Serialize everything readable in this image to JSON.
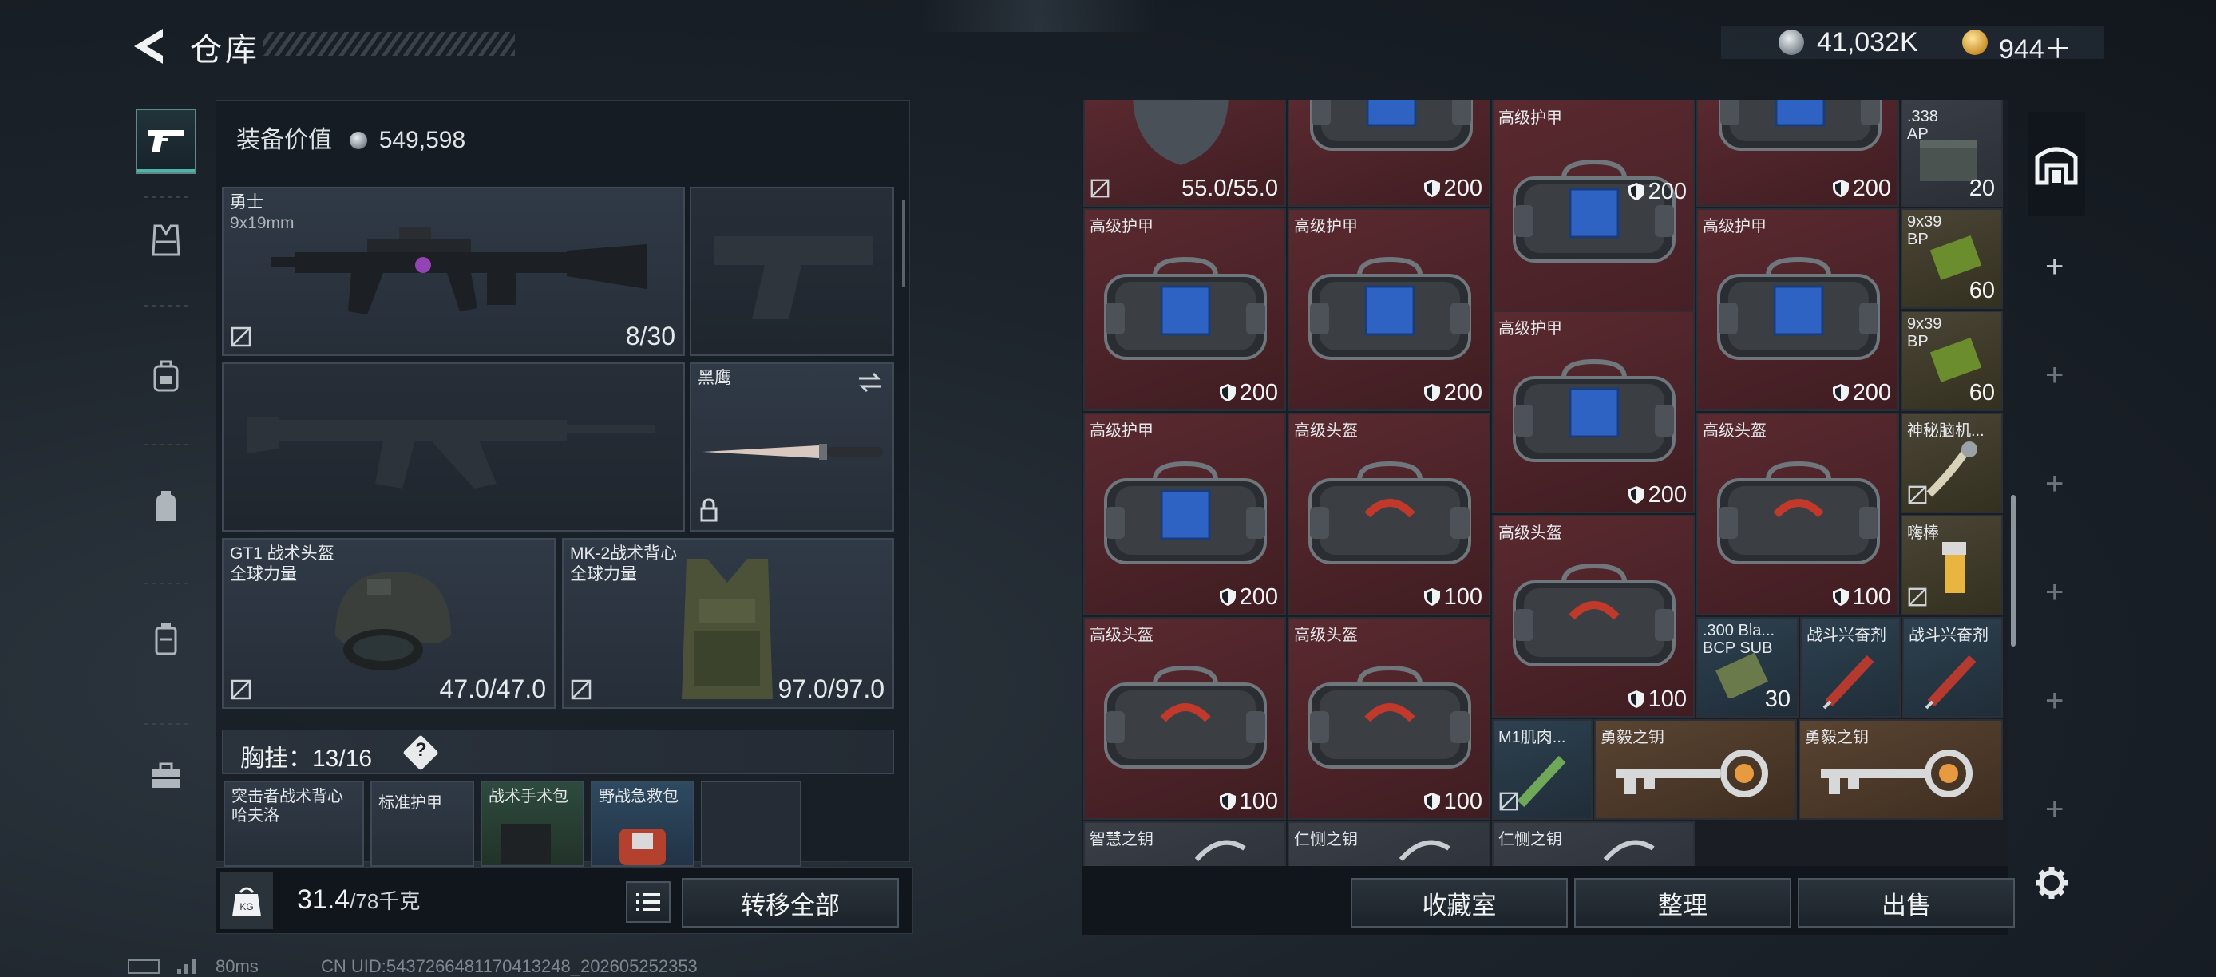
{
  "header": {
    "title": "仓库",
    "currency1": "41,032K",
    "currency2": "944＋"
  },
  "loadout": {
    "value_label": "装备价值",
    "value": "549,598",
    "primary": {
      "name": "勇士",
      "caliber": "9x19mm",
      "ammo": "8/30"
    },
    "melee": {
      "name": "黑鹰"
    },
    "helmet": {
      "name": "GT1 战术头盔",
      "brand": "全球力量",
      "durability": "47.0/47.0"
    },
    "vest": {
      "name": "MK-2战术背心",
      "brand": "全球力量",
      "durability": "97.0/97.0"
    },
    "chest_rig": {
      "label": "胸挂：13/16",
      "help": "?"
    },
    "chest_items": [
      "突击者战术背心",
      "哈夫洛",
      "标准护甲",
      "战术手术包",
      "野战急救包"
    ],
    "weight": "31.4",
    "weight_max": "/78千克",
    "transfer_all": "转移全部"
  },
  "stash": {
    "cells": [
      {
        "label": "",
        "num": "55.0/55.0"
      },
      {
        "label": "",
        "num": "200"
      },
      {
        "label": "高级护甲",
        "num": "200"
      },
      {
        "label": "",
        "num": "200"
      },
      {
        "label": ".338\nAP",
        "num": "20"
      },
      {
        "label": "高级护甲",
        "num": "200"
      },
      {
        "label": "高级护甲",
        "num": "200"
      },
      {
        "label": "",
        "num": "200"
      },
      {
        "label": "高级护甲",
        "num": "200"
      },
      {
        "label": "9x39\nBP",
        "num": "60"
      },
      {
        "label": "高级护甲",
        "num": "200"
      },
      {
        "label": "9x39\nBP",
        "num": "60"
      },
      {
        "label": "高级护甲",
        "num": "200"
      },
      {
        "label": "高级头盔",
        "num": "100"
      },
      {
        "label": "高级头盔",
        "num": "100"
      },
      {
        "label": "神秘脑机...",
        "num": ""
      },
      {
        "label": "嗨棒",
        "num": ""
      },
      {
        "label": "高级头盔",
        "num": "100"
      },
      {
        "label": "高级头盔",
        "num": "100"
      },
      {
        "label": "高级头盔",
        "num": "100"
      },
      {
        "label": ".300 Bla...\nBCP SUB",
        "num": "30"
      },
      {
        "label": "战斗兴奋剂",
        "num": ""
      },
      {
        "label": "战斗兴奋剂",
        "num": ""
      },
      {
        "label": "M1肌肉...",
        "num": ""
      },
      {
        "label": "勇毅之钥",
        "num": ""
      },
      {
        "label": "勇毅之钥",
        "num": ""
      },
      {
        "label": "智慧之钥",
        "num": ""
      },
      {
        "label": "仁恻之钥",
        "num": ""
      },
      {
        "label": "仁恻之钥",
        "num": ""
      }
    ],
    "buttons": {
      "collection": "收藏室",
      "sort": "整理",
      "sell": "出售"
    }
  },
  "footer": {
    "ping": "80ms",
    "uid": "CN UID:5437266481170413248_202605252353"
  }
}
